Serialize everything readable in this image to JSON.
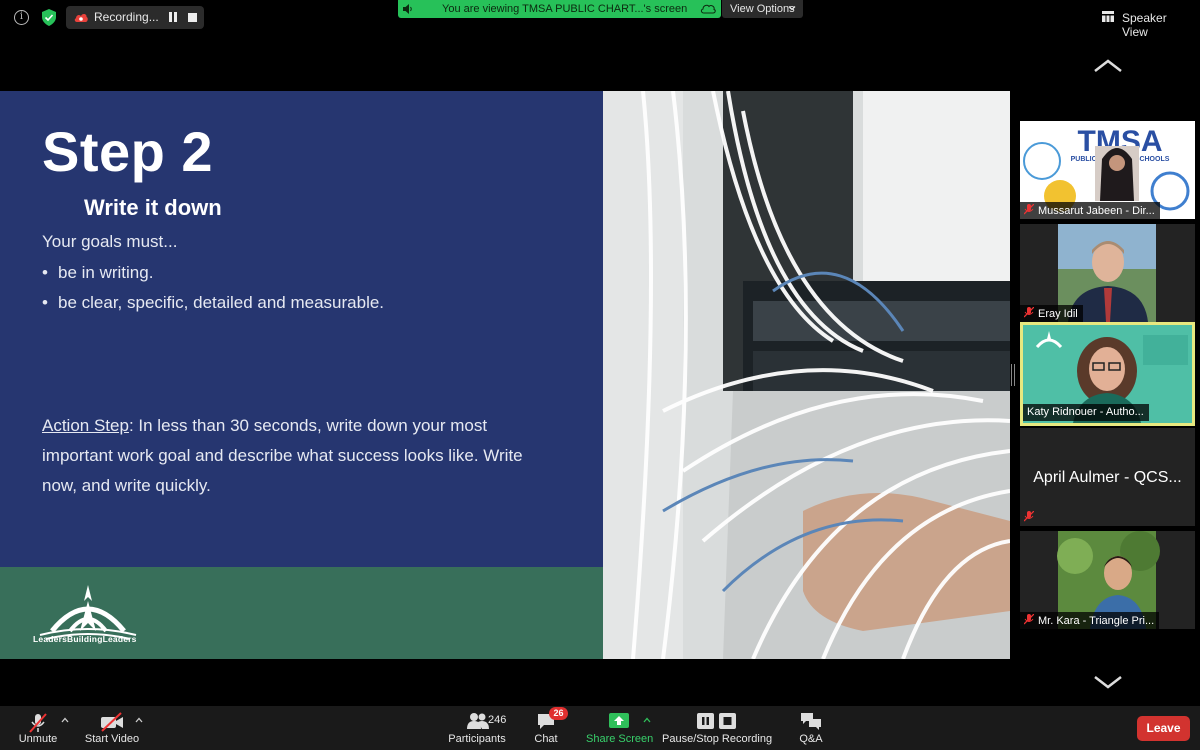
{
  "top_bar": {
    "recording_label": "Recording...",
    "banner_text": "You are viewing TMSA PUBLIC CHART...'s screen",
    "view_options_label": "View Options",
    "speaker_view_label": "Speaker View"
  },
  "slide": {
    "title": "Step 2",
    "subtitle": "Write it down",
    "intro": "Your goals must...",
    "bullets": [
      "be in writing.",
      "be clear, specific, detailed and measurable."
    ],
    "action_label": "Action Step",
    "action_text": ": In less than 30 seconds, write down your most important work goal and describe what success looks like. Write now, and write quickly.",
    "logo_text": "LeadersBuildingLeaders"
  },
  "participants": [
    {
      "name": "Mussarut Jabeen - Dir...",
      "video": true,
      "muted": true
    },
    {
      "name": "Eray Idil",
      "video": true,
      "muted": true
    },
    {
      "name": "Katy Ridnouer - Autho...",
      "video": true,
      "muted": false,
      "active_speaker": true
    },
    {
      "name": "April Aulmer - QCS...",
      "video": false,
      "muted": true
    },
    {
      "name": "Mr. Kara - Triangle Pri...",
      "video": true,
      "muted": true
    }
  ],
  "toolbar": {
    "unmute": "Unmute",
    "start_video": "Start Video",
    "participants": "Participants",
    "participants_count": "246",
    "chat": "Chat",
    "chat_badge": "26",
    "share_screen": "Share Screen",
    "pause_stop_recording": "Pause/Stop Recording",
    "qa": "Q&A",
    "leave": "Leave"
  },
  "colors": {
    "slide_blue": "#263670",
    "slide_green": "#386f5a",
    "banner_green": "#27c159",
    "active_border": "#e7e87f",
    "leave_red": "#d2332f",
    "share_green": "#38d06b"
  }
}
